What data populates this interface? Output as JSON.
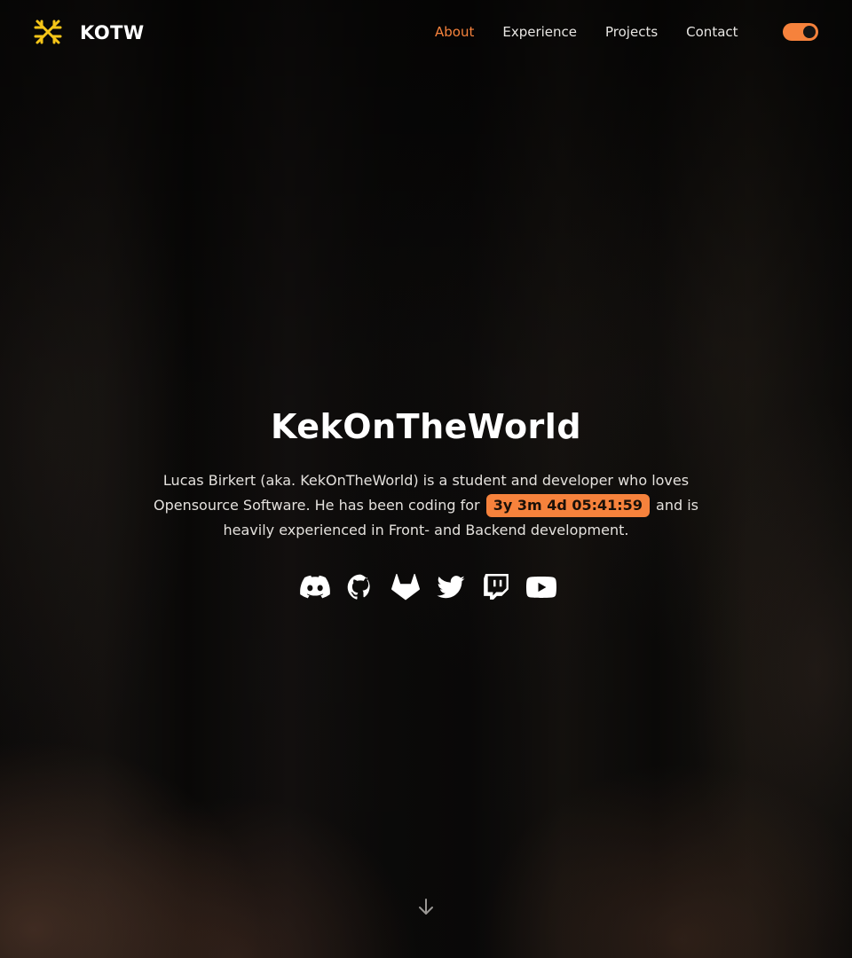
{
  "header": {
    "brand": "KOTW",
    "logo_icon": "kotw-logo-icon",
    "nav": [
      {
        "label": "About",
        "active": true
      },
      {
        "label": "Experience",
        "active": false
      },
      {
        "label": "Projects",
        "active": false
      },
      {
        "label": "Contact",
        "active": false
      }
    ],
    "theme_toggle": {
      "icon": "theme-toggle",
      "state": "dark"
    }
  },
  "hero": {
    "title": "KekOnTheWorld",
    "text_before": "Lucas Birkert (aka. KekOnTheWorld) is a student and developer who loves Opensource Software. He has been coding for",
    "timer": "3y 3m 4d 05:41:59",
    "text_after": "and is heavily experienced in Front- and Backend development."
  },
  "socials": [
    {
      "name": "discord-icon"
    },
    {
      "name": "github-icon"
    },
    {
      "name": "gitlab-icon"
    },
    {
      "name": "twitter-icon"
    },
    {
      "name": "twitch-icon"
    },
    {
      "name": "youtube-icon"
    }
  ],
  "scroll_indicator": {
    "icon": "arrow-down-icon"
  },
  "colors": {
    "accent": "#f6823c",
    "logo": "#f5c518",
    "text": "#ffffff",
    "background": "#0a0908"
  }
}
